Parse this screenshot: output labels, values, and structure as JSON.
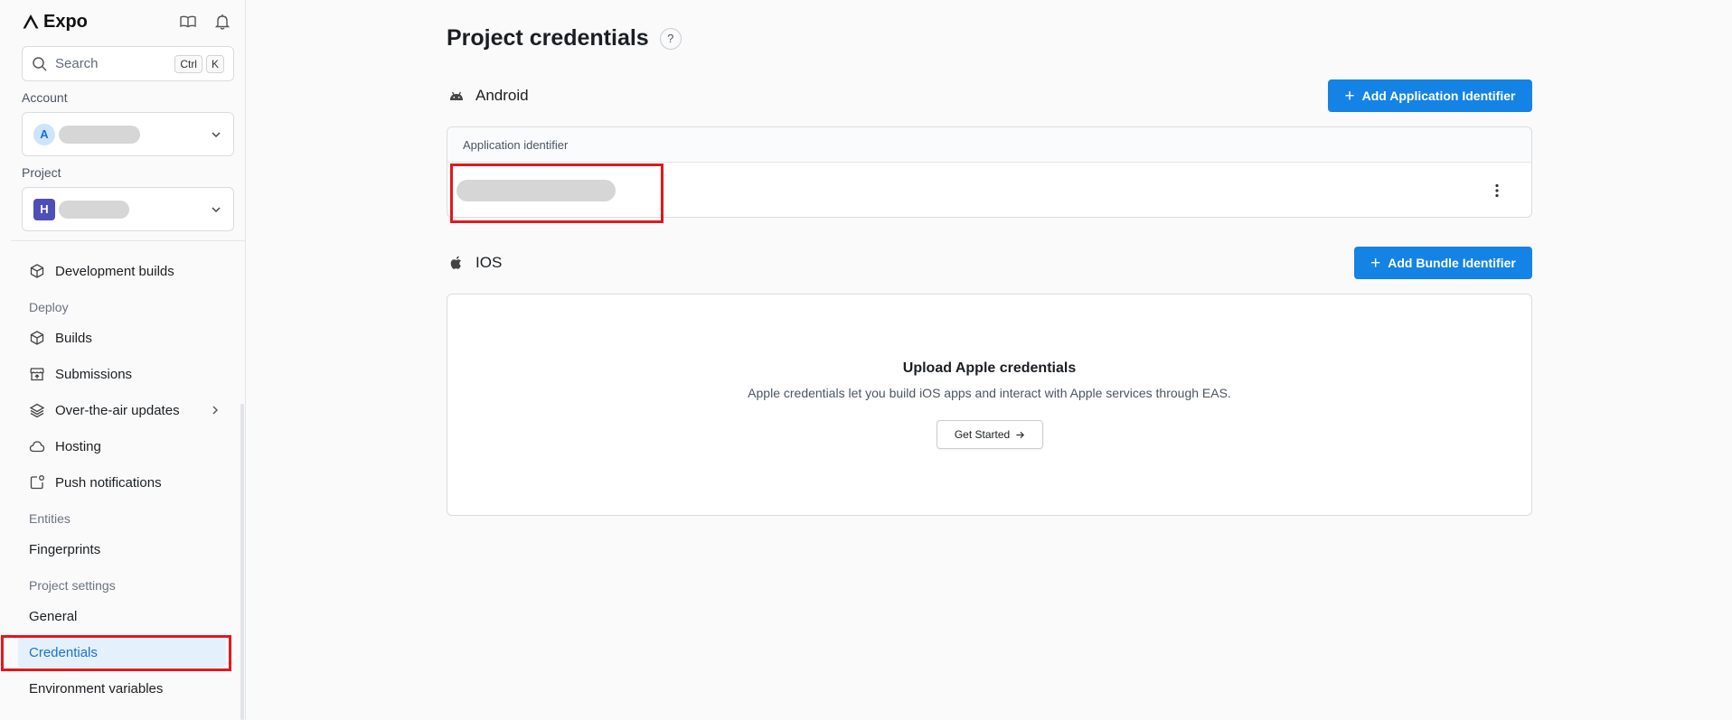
{
  "app": {
    "name": "Expo"
  },
  "sidebar": {
    "search": {
      "placeholder": "Search",
      "key1": "Ctrl",
      "key2": "K"
    },
    "account": {
      "label": "Account",
      "avatar_letter": "A"
    },
    "project": {
      "label": "Project",
      "avatar_letter": "H"
    },
    "nav": {
      "development_builds": "Development builds",
      "deploy_section": "Deploy",
      "builds": "Builds",
      "submissions": "Submissions",
      "ota_updates": "Over-the-air updates",
      "hosting": "Hosting",
      "push_notifications": "Push notifications",
      "entities_section": "Entities",
      "fingerprints": "Fingerprints",
      "project_settings_section": "Project settings",
      "general": "General",
      "credentials": "Credentials",
      "environment_variables": "Environment variables"
    },
    "active_item": "Credentials"
  },
  "main": {
    "title": "Project credentials",
    "help_glyph": "?",
    "android": {
      "label": "Android",
      "add_button": "Add Application Identifier",
      "table_header": "Application identifier"
    },
    "ios": {
      "label": "IOS",
      "add_button": "Add Bundle Identifier",
      "empty_title": "Upload Apple credentials",
      "empty_description": "Apple credentials let you build iOS apps and interact with Apple services through EAS.",
      "get_started": "Get Started"
    }
  },
  "colors": {
    "accent": "#1483e6",
    "active_bg": "#e4f0fb",
    "active_text": "#1a73c9",
    "highlight": "#e0191b"
  },
  "icons": [
    "expo-logo-icon",
    "docs-book-icon",
    "bell-icon",
    "search-icon",
    "chevron-down-icon",
    "cube-icon",
    "store-icon",
    "layers-icon",
    "cloud-icon",
    "notification-icon",
    "chevron-right-icon",
    "android-icon",
    "apple-icon",
    "plus-icon",
    "more-vertical-icon",
    "arrow-right-icon"
  ]
}
